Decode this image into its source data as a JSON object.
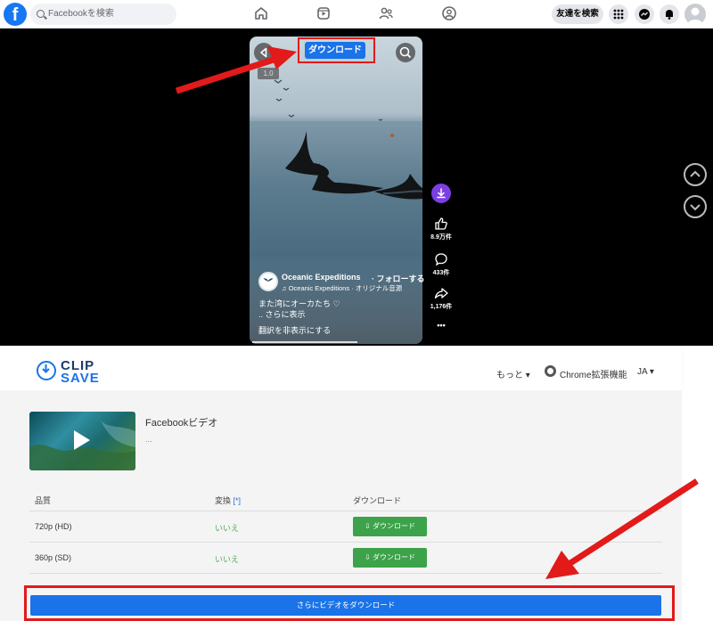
{
  "facebook": {
    "search_placeholder": "Facebookを検索",
    "logo": "f",
    "find_friends": "友達を検索"
  },
  "reel": {
    "download_label": "ダウンロード",
    "speed": "1.0",
    "likes": "8.9万件",
    "comments": "433件",
    "shares": "1,176件",
    "more": "•••",
    "channel": "Oceanic Expeditions",
    "follow": "· フォローする",
    "audio": "♫ Oceanic Expeditions · オリジナル音源",
    "caption": "また湾にオーカたち ♡",
    "see_more": ".. さらに表示",
    "hide_translation": "翻訳を非表示にする"
  },
  "clipsave": {
    "logo_line1": "CLIP",
    "logo_line2": "SAVE",
    "nav_more": "もっと ▾",
    "nav_chrome": "Chrome拡張機能",
    "nav_lang": "JA ▾",
    "video_title": "Facebookビデオ",
    "video_sub": "...",
    "table": {
      "col_quality": "品質",
      "col_convert": "変換",
      "col_convert_note": "[*]",
      "col_download": "ダウンロード",
      "rows": [
        {
          "quality": "720p (HD)",
          "convert": "いいえ",
          "button": "⇩ ダウンロード"
        },
        {
          "quality": "360p (SD)",
          "convert": "いいえ",
          "button": "⇩ ダウンロード"
        }
      ]
    },
    "more_videos_button": "さらにビデオをダウンロード"
  },
  "colors": {
    "facebook_blue": "#1877f2",
    "download_blue": "#1a73e8",
    "highlight_red": "#e21a1a",
    "green": "#3ca34a"
  }
}
